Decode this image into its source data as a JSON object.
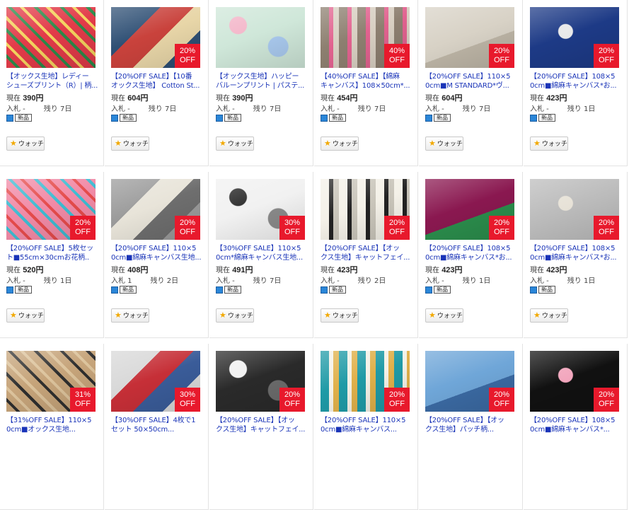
{
  "watch_label": "ウォッチ",
  "new_label": "新品",
  "price_prefix": "現在",
  "bid_prefix": "入札",
  "remaining_prefix": "残り",
  "rows": [
    [
      {
        "title1": "【オックス生地】レディー",
        "title2": "シューズプリント（R）| 柄...",
        "price": "390円",
        "bids": "-",
        "remaining": "7日",
        "badge": "",
        "colors": [
          "#e23b49",
          "#2b8a4a",
          "#f4d35e"
        ]
      },
      {
        "title1": "【20%OFF SALE】【10番",
        "title2": "オックス生地】 Cotton St...",
        "price": "604円",
        "bids": "-",
        "remaining": "7日",
        "badge": "20%",
        "colors": [
          "#2e4f74",
          "#c9423c",
          "#e8d6a8"
        ]
      },
      {
        "title1": "【オックス生地】ハッピー",
        "title2": "バルーンプリント | パステ...",
        "price": "390円",
        "bids": "-",
        "remaining": "7日",
        "badge": "",
        "colors": [
          "#cfe7d9",
          "#f3b6c9",
          "#a9c9ee"
        ]
      },
      {
        "title1": "【40%OFF SALE】【綿麻",
        "title2": "キャンバス】108×50cm*...",
        "price": "454円",
        "bids": "-",
        "remaining": "7日",
        "badge": "40%",
        "colors": [
          "#8d7f70",
          "#e1628f",
          "#d8cfc2"
        ]
      },
      {
        "title1": "【20%OFF SALE】110×5",
        "title2": "0cm■M STANDARD*ヴ...",
        "price": "604円",
        "bids": "-",
        "remaining": "7日",
        "badge": "20%",
        "colors": [
          "#d8d2c6",
          "#3a3a3a",
          "#bdb5a6"
        ]
      },
      {
        "title1": "【20%OFF SALE】108×5",
        "title2": "0cm■綿麻キャンバス*お...",
        "price": "423円",
        "bids": "-",
        "remaining": "1日",
        "badge": "20%",
        "colors": [
          "#1d3a86",
          "#e9e9e9",
          "#f0c23a"
        ]
      }
    ],
    [
      {
        "title1": "【20%OFF SALE】5枚セッ",
        "title2": "ト■55cm×30cmお花柄..",
        "price": "520円",
        "bids": "-",
        "remaining": "1日",
        "badge": "20%",
        "colors": [
          "#f18aa6",
          "#3dbbd1",
          "#e54b4b"
        ]
      },
      {
        "title1": "【20%OFF SALE】110×5",
        "title2": "0cm■綿麻キャンバス生地...",
        "price": "408円",
        "bids": "1",
        "remaining": "2日",
        "badge": "20%",
        "colors": [
          "#9b9b9b",
          "#e8e4d9",
          "#6e6e6e"
        ]
      },
      {
        "title1": "【30%OFF SALE】110×5",
        "title2": "0cm*綿麻キャンバス生地...",
        "price": "491円",
        "bids": "-",
        "remaining": "7日",
        "badge": "30%",
        "colors": [
          "#f1f1f1",
          "#2b2b2b",
          "#8a8a8a"
        ]
      },
      {
        "title1": "【20%OFF SALE】【オッ",
        "title2": "クス生地】キャットフェイ...",
        "price": "423円",
        "bids": "-",
        "remaining": "2日",
        "badge": "20%",
        "colors": [
          "#f4f1e8",
          "#222222",
          "#c9c5ba"
        ]
      },
      {
        "title1": "【20%OFF SALE】108×5",
        "title2": "0cm■綿麻キャンバス*お...",
        "price": "423円",
        "bids": "-",
        "remaining": "1日",
        "badge": "20%",
        "colors": [
          "#8a1850",
          "#f0e6d8",
          "#2b8d4c"
        ]
      },
      {
        "title1": "【20%OFF SALE】108×5",
        "title2": "0cm■綿麻キャンバス*お...",
        "price": "423円",
        "bids": "-",
        "remaining": "1日",
        "badge": "20%",
        "colors": [
          "#bcbcbc",
          "#e7e2d7",
          "#7a6b5a"
        ]
      }
    ],
    [
      {
        "title1": "【31%OFF SALE】110×5",
        "title2": "0cm■オックス生地...",
        "price": "",
        "bids": "",
        "remaining": "",
        "badge": "31%",
        "colors": [
          "#c6a47a",
          "#2e2e2e",
          "#dcc39c"
        ]
      },
      {
        "title1": "【30%OFF SALE】4枚で1",
        "title2": "セット 50×50cm...",
        "price": "",
        "bids": "",
        "remaining": "",
        "badge": "30%",
        "colors": [
          "#d8d8d8",
          "#c62f37",
          "#3a5c99"
        ]
      },
      {
        "title1": "【20%OFF SALE】【オッ",
        "title2": "クス生地】キャットフェイ...",
        "price": "",
        "bids": "",
        "remaining": "",
        "badge": "20%",
        "colors": [
          "#2a2a2a",
          "#f1f1f1",
          "#6b6b6b"
        ]
      },
      {
        "title1": "【20%OFF SALE】110×5",
        "title2": "0cm■綿麻キャンバス...",
        "price": "",
        "bids": "",
        "remaining": "",
        "badge": "20%",
        "colors": [
          "#1f9aa6",
          "#f4f1e8",
          "#e0b04a"
        ]
      },
      {
        "title1": "【20%OFF SALE】【オッ",
        "title2": "クス生地】パッチ柄...",
        "price": "",
        "bids": "",
        "remaining": "",
        "badge": "20%",
        "colors": [
          "#6fa6d8",
          "#e9eef5",
          "#3b6aa3"
        ]
      },
      {
        "title1": "【20%OFF SALE】108×5",
        "title2": "0cm■綿麻キャンバス*...",
        "price": "",
        "bids": "",
        "remaining": "",
        "badge": "20%",
        "colors": [
          "#111111",
          "#f2a6bd",
          "#ffffff"
        ]
      }
    ]
  ]
}
